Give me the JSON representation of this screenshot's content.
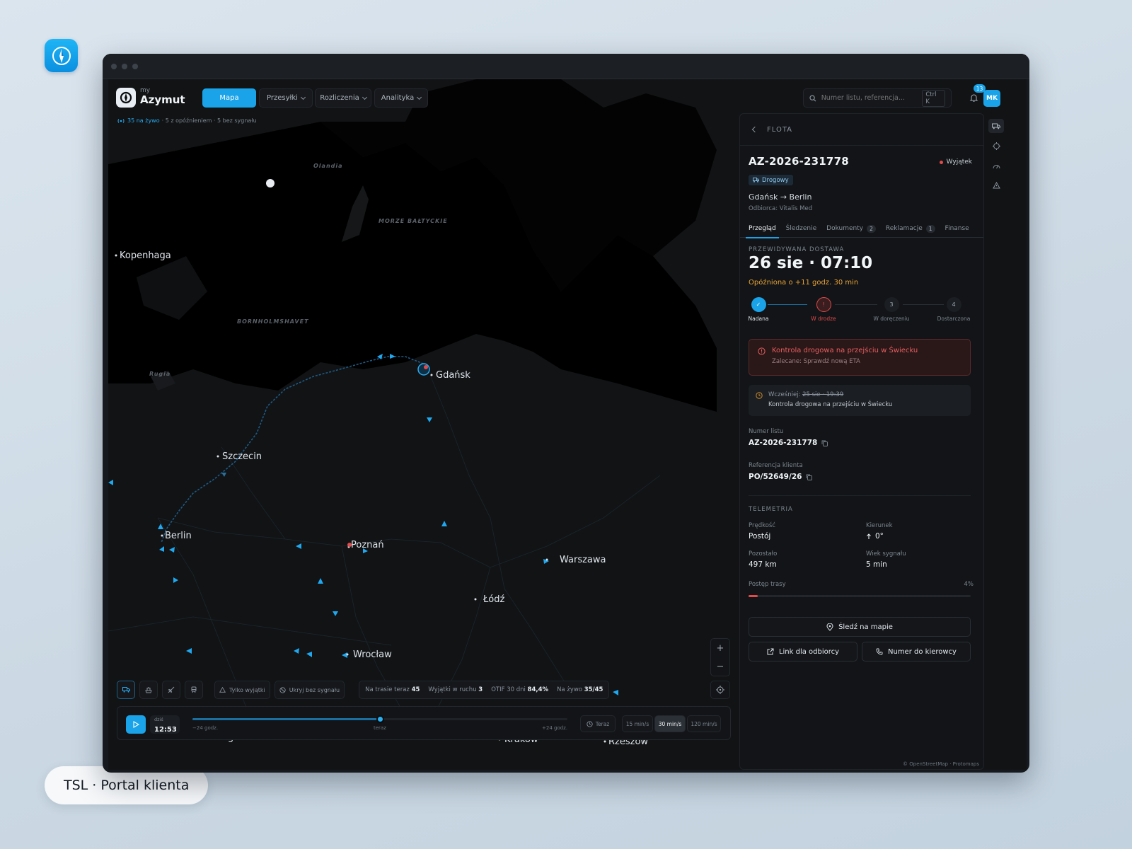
{
  "caption": "TSL · Portal klienta",
  "logo": {
    "small": "my",
    "name": "Azymut"
  },
  "nav": [
    {
      "label": "Mapa",
      "active": true
    },
    {
      "label": "Przesyłki",
      "dropdown": true
    },
    {
      "label": "Rozliczenia",
      "dropdown": true
    },
    {
      "label": "Analityka",
      "dropdown": true
    }
  ],
  "search": {
    "placeholder": "Numer listu, referencja...",
    "shortcut": "Ctrl K"
  },
  "notifications": {
    "count": "13"
  },
  "user": {
    "initials": "MK"
  },
  "status": {
    "live": "35 na żywo",
    "rest": "· 5 z opóźnieniem · 5 bez sygnału"
  },
  "map": {
    "cities": [
      "Kopenhaga",
      "Gdańsk",
      "Szczecin",
      "Berlin",
      "Poznań",
      "Warszawa",
      "Łódź",
      "Wrocław",
      "Kraków",
      "Rzeszów",
      "Praga"
    ],
    "seas": [
      "Olandia",
      "MORZE BAŁTYCKIE",
      "BORNHOLMSHAVET",
      "Rugia"
    ],
    "attribution": "© OpenStreetMap · Protomaps"
  },
  "panel": {
    "section": "FLOTA",
    "id": "AZ-2026-231778",
    "exception": "Wyjątek",
    "mode": "Drogowy",
    "route": "Gdańsk → Berlin",
    "recipient": "Odbiorca: Vitalis Med",
    "tabs": [
      {
        "label": "Przegląd",
        "selected": true
      },
      {
        "label": "Śledzenie"
      },
      {
        "label": "Dokumenty",
        "count": "2"
      },
      {
        "label": "Reklamacje",
        "count": "1"
      },
      {
        "label": "Finanse"
      }
    ],
    "eta_label": "PRZEWIDYWANA DOSTAWA",
    "eta": "26 sie · 07:10",
    "delay": "Opóźniona o +11 godz. 30 min",
    "steps": [
      {
        "label": "Nadana",
        "state": "done",
        "mark": "✓"
      },
      {
        "label": "W drodze",
        "state": "current",
        "mark": "!"
      },
      {
        "label": "W doręczeniu",
        "state": "todo",
        "mark": "3"
      },
      {
        "label": "Dostarczona",
        "state": "todo",
        "mark": "4"
      }
    ],
    "alert": {
      "title": "Kontrola drogowa na przejściu w Świecku",
      "sub": "Zalecane: Sprawdź nową ETA"
    },
    "previous": {
      "prefix": "Wcześniej:",
      "old": "25 sie · 19:39",
      "text": "Kontrola drogowa na przejściu w Świecku"
    },
    "waybill": {
      "label": "Numer listu",
      "value": "AZ-2026-231778"
    },
    "reference": {
      "label": "Referencja klienta",
      "value": "PO/52649/26"
    },
    "telemetry": {
      "title": "TELEMETRIA",
      "speed_label": "Prędkość",
      "speed": "Postój",
      "heading_label": "Kierunek",
      "heading": "0°",
      "remaining_label": "Pozostało",
      "remaining": "497 km",
      "signal_label": "Wiek sygnału",
      "signal": "5 min",
      "progress_label": "Postęp trasy",
      "progress_text": "4%",
      "progress": 0.04
    },
    "buttons": {
      "track": "Śledź na mapie",
      "link": "Link dla odbiorcy",
      "driver": "Numer do kierowcy"
    }
  },
  "filters": {
    "exceptions_only": "Tylko wyjątki",
    "hide_no_signal": "Ukryj bez sygnału"
  },
  "stats": [
    {
      "label": "Na trasie teraz",
      "value": "45"
    },
    {
      "label": "Wyjątki w ruchu",
      "value": "3"
    },
    {
      "label": "OTIF 30 dni",
      "value": "84,4%"
    },
    {
      "label": "Na żywo",
      "value": "35/45"
    }
  ],
  "timeline": {
    "day": "dziś",
    "time": "12:53",
    "start": "−24 godz.",
    "now": "teraz",
    "end": "+24 godz.",
    "position": 0.5,
    "now_btn": "Teraz",
    "speeds": [
      {
        "label": "15 min/s"
      },
      {
        "label": "30 min/s",
        "selected": true
      },
      {
        "label": "120 min/s"
      }
    ]
  },
  "colors": {
    "accent": "#1aa3e8",
    "danger": "#e14b4b",
    "warning": "#e7a236"
  }
}
